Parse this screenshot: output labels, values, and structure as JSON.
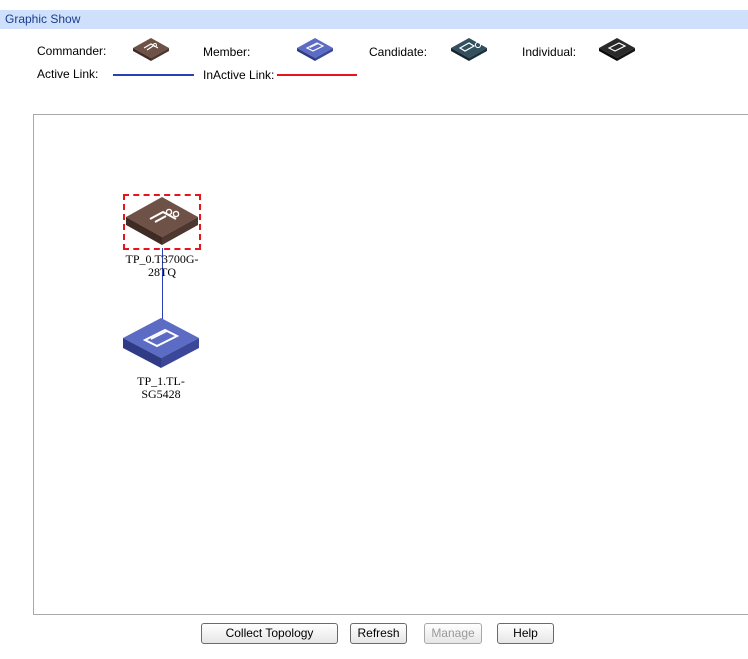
{
  "header": {
    "title": "Graphic Show"
  },
  "legend": {
    "commander_label": "Commander:",
    "member_label": "Member:",
    "candidate_label": "Candidate:",
    "individual_label": "Individual:",
    "active_link_label": "Active Link:",
    "inactive_link_label": "InActive Link:",
    "colors": {
      "commander": "#5a4036",
      "member": "#4553a6",
      "candidate": "#1f3442",
      "individual": "#1c1c1c",
      "active_link": "#2a3fb5",
      "inactive_link": "#e8141c"
    }
  },
  "topology": {
    "nodes": [
      {
        "label_line1": "TP_0.T3700G-",
        "label_line2": "28TQ",
        "role": "commander",
        "icon": "commander-switch-icon",
        "selected": true
      },
      {
        "label_line1": "TP_1.TL-",
        "label_line2": "SG5428",
        "role": "member",
        "icon": "member-switch-icon",
        "selected": false
      }
    ],
    "links": [
      {
        "from": 0,
        "to": 1,
        "status": "active"
      }
    ]
  },
  "buttons": {
    "collect_topology": "Collect Topology",
    "refresh": "Refresh",
    "manage": "Manage",
    "help": "Help"
  }
}
